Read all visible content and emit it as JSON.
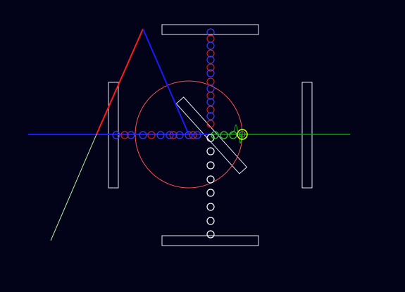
{
  "colors": {
    "background": "#020218",
    "mirror": "#e8e8f0",
    "beam_blue": "#1a1aff",
    "beam_red": "#ff1a1a",
    "beam_green": "#10a010",
    "beam_lightgreen": "#b8f0a0",
    "ring_red": "#ff5050",
    "circle_white": "#ffffff",
    "circle_blue": "#3a3aff",
    "circle_red": "#cc2020",
    "circle_green": "#2ad02a",
    "marker_yellow": "#ccff00"
  }
}
